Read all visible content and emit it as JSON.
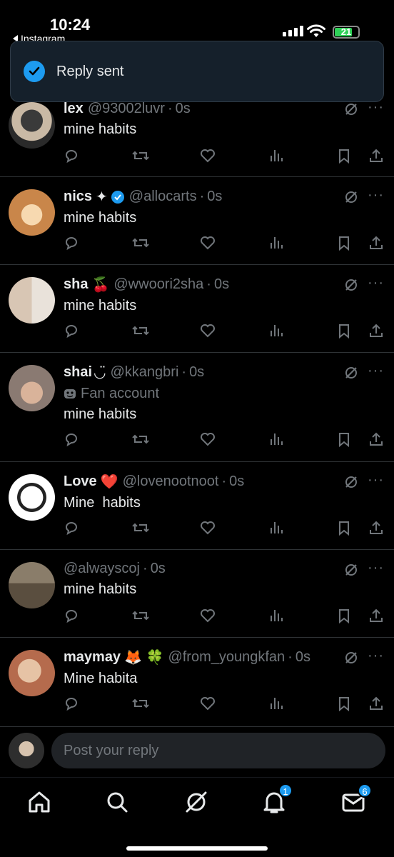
{
  "status_bar": {
    "time": "10:24",
    "back_app": "Instagram",
    "battery": "21"
  },
  "toast": {
    "message": "Reply sent"
  },
  "tweets": [
    {
      "name": "lex",
      "emoji": "",
      "handle": "@93002luvr",
      "time": "0s",
      "text": "mine habits",
      "fan_account": ""
    },
    {
      "name": "nics",
      "emoji": "✦",
      "verified": true,
      "handle": "@allocarts",
      "time": "0s",
      "text": "mine habits",
      "fan_account": ""
    },
    {
      "name": "sha",
      "emoji": "🍒",
      "handle": "@wwoori2sha",
      "time": "0s",
      "text": "mine habits",
      "fan_account": ""
    },
    {
      "name": "shai",
      "emoji": "◡̈",
      "handle": "@kkangbri",
      "time": "0s",
      "text": "mine habits",
      "fan_account": "Fan account"
    },
    {
      "name": "Love",
      "emoji": "❤️",
      "handle": "@lovenootnoot",
      "time": "0s",
      "text": "Mine  habits",
      "fan_account": ""
    },
    {
      "name": "",
      "emoji": "",
      "handle": "@alwayscoj",
      "time": "0s",
      "text": "mine habits",
      "fan_account": ""
    },
    {
      "name": "maymay",
      "emoji": "🦊 🍀",
      "handle": "@from_youngkfan",
      "time": "0s",
      "text": "Mine habita",
      "fan_account": ""
    }
  ],
  "reply": {
    "placeholder": "Post your reply"
  },
  "nav": {
    "notifications_badge": "1",
    "messages_badge": "6"
  },
  "icons": [
    "reply-icon",
    "repost-icon",
    "like-icon",
    "views-icon",
    "bookmark-icon",
    "share-icon",
    "grok-icon",
    "more-icon"
  ],
  "colors": {
    "accent": "#1d9bf0",
    "muted": "#71767b",
    "background": "#000000"
  }
}
